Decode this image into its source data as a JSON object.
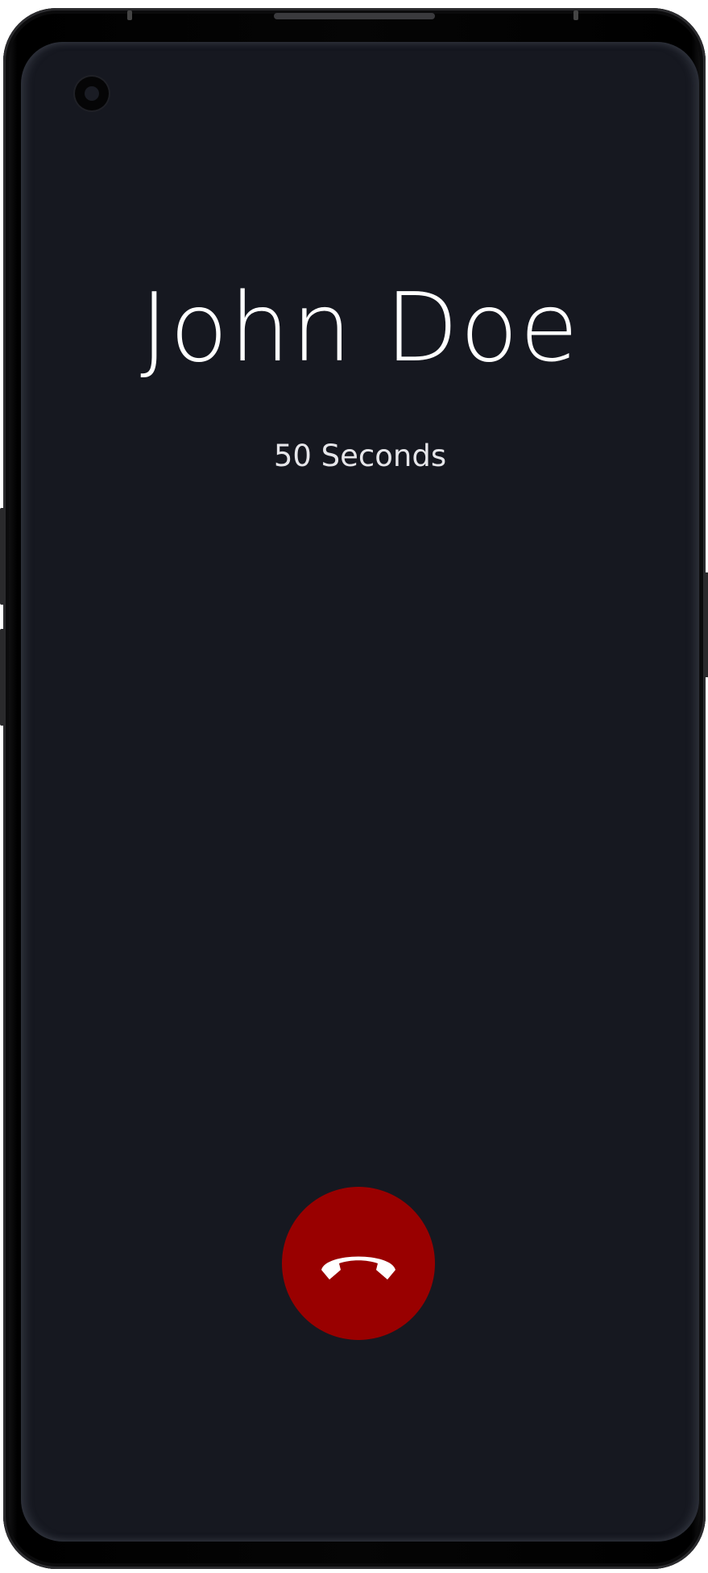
{
  "call": {
    "caller_name": "John Doe",
    "duration": "50 Seconds"
  },
  "controls": {
    "end_call_icon": "phone-hangup-icon"
  },
  "colors": {
    "background": "#161820",
    "end_call": "#990000",
    "text": "#ffffff"
  }
}
